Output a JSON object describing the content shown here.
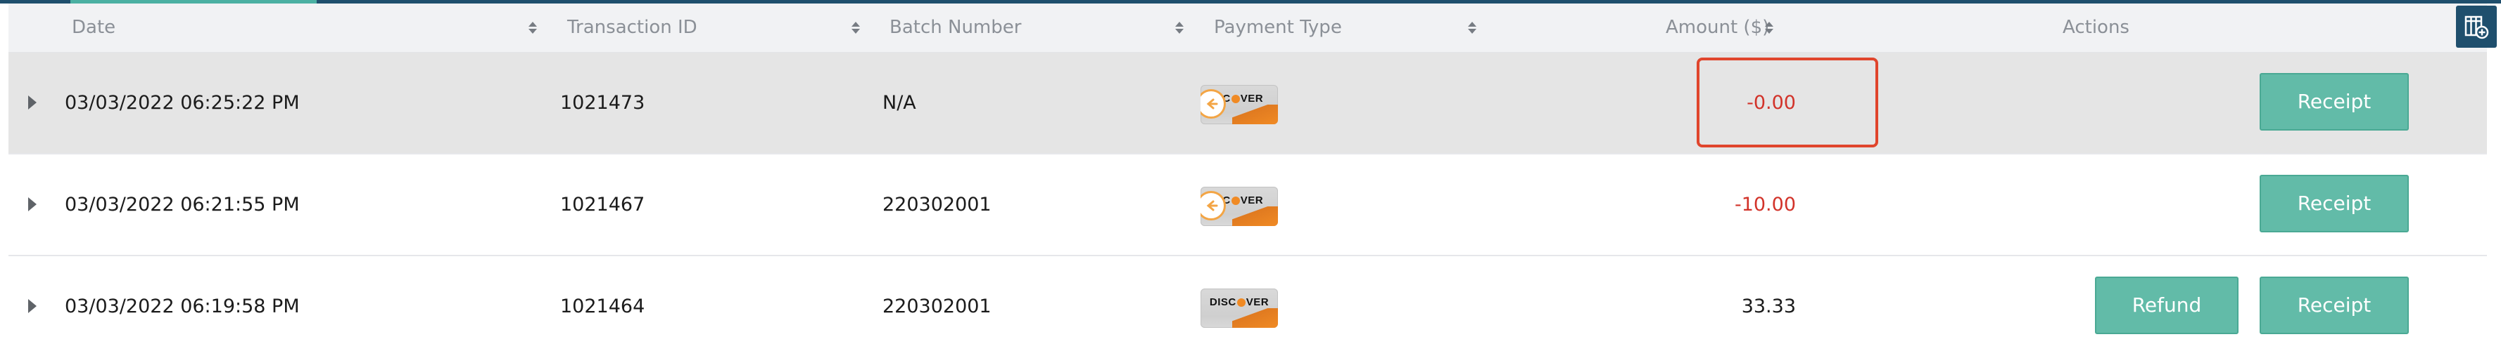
{
  "table": {
    "headers": {
      "date": "Date",
      "transaction_id": "Transaction ID",
      "batch_number": "Batch Number",
      "payment_type": "Payment Type",
      "amount": "Amount ($)",
      "actions": "Actions"
    },
    "rows": [
      {
        "date": "03/03/2022 06:25:22 PM",
        "transaction_id": "1021473",
        "batch_number": "N/A",
        "card_brand": "SC  VER",
        "card_icon": "discover-card-with-return-icon",
        "amount": "-0.00",
        "receipt_label": "Receipt"
      },
      {
        "date": "03/03/2022 06:21:55 PM",
        "transaction_id": "1021467",
        "batch_number": "220302001",
        "card_brand": "SC  VER",
        "card_icon": "discover-card-with-return-icon",
        "amount": "-10.00",
        "receipt_label": "Receipt"
      },
      {
        "date": "03/03/2022 06:19:58 PM",
        "transaction_id": "1021464",
        "batch_number": "220302001",
        "card_brand": "DISC  VER",
        "card_icon": "discover-card-icon",
        "amount": "33.33",
        "refund_label": "Refund",
        "receipt_label": "Receipt"
      }
    ]
  },
  "colors": {
    "accent_teal": "#62bba8",
    "negative_red": "#d2332a",
    "highlight_outline": "#e0452c",
    "header_navy": "#1f4f6d"
  },
  "icons": {
    "row_expand": "caret-right-icon",
    "column_settings": "table-columns-settings-icon",
    "sort": "sort-arrows-icon"
  }
}
